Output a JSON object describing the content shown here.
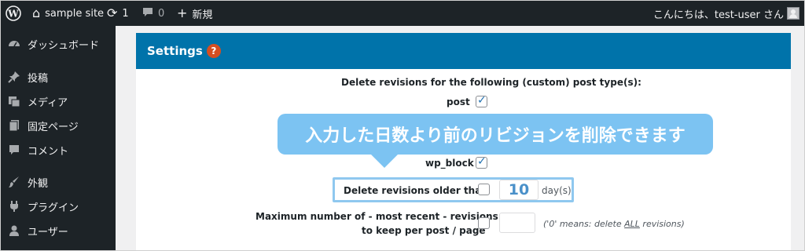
{
  "adminbar": {
    "site_name": "sample site",
    "updates_count": "1",
    "comments_count": "0",
    "new_label": "新規",
    "greeting": "こんにちは、test-user さん"
  },
  "sidebar": {
    "items": [
      {
        "label": "ダッシュボード",
        "icon": "dashboard-icon"
      },
      {
        "label": "投稿",
        "icon": "pin-icon"
      },
      {
        "label": "メディア",
        "icon": "media-icon"
      },
      {
        "label": "固定ページ",
        "icon": "page-icon"
      },
      {
        "label": "コメント",
        "icon": "comment-icon"
      },
      {
        "label": "外観",
        "icon": "paintbrush-icon"
      },
      {
        "label": "プラグイン",
        "icon": "plugin-icon"
      },
      {
        "label": "ユーザー",
        "icon": "user-icon"
      }
    ]
  },
  "settings": {
    "title": "Settings",
    "help_symbol": "?",
    "post_types_heading": "Delete revisions for the following (custom) post type(s):",
    "post_types": [
      {
        "label": "post",
        "checked": true
      },
      {
        "label": "wp_block",
        "checked": true
      }
    ],
    "older_than_label": "Delete revisions older than",
    "older_than_checked": false,
    "older_than_value": "10",
    "older_than_unit": "day(s)",
    "max_number_label_line1": "Maximum number of - most recent - revisions",
    "max_number_label_line2": "to keep per post / page",
    "max_number_checked": false,
    "max_number_value": "",
    "max_number_note_prefix": "('0' means: delete ",
    "max_number_note_all": "ALL",
    "max_number_note_suffix": " revisions)"
  },
  "callout": {
    "text": "入力した日数より前のリビジョンを削除できます"
  }
}
